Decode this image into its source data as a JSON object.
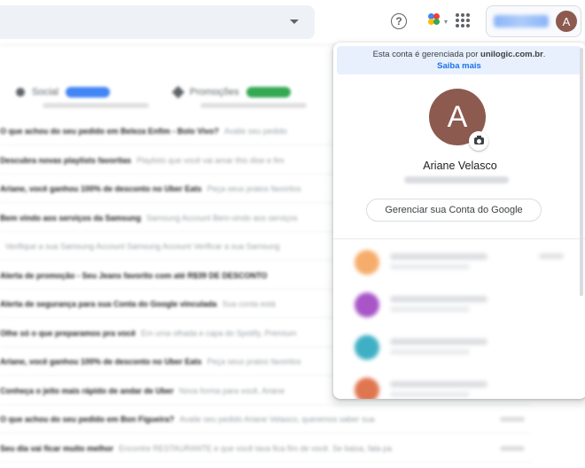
{
  "topbar": {
    "help_icon_glyph": "?",
    "account_initial": "A"
  },
  "inbox": {
    "tabs": [
      {
        "label": "Social",
        "color": "#4285f4"
      },
      {
        "label": "Promoções",
        "color": "#34a853"
      }
    ],
    "rows": [
      {
        "subject": "O que achou do seu pedido em Beleza Enfim - Bolo Vivo?",
        "preview": "Avalie seu pedido"
      },
      {
        "subject": "Descubra novas playlists favoritas",
        "preview": "Playlists que você vai amar this dise e fim"
      },
      {
        "subject": "Ariane, você ganhou 100% de desconto no Uber Eats",
        "preview": "Peça seus pratos favoritos"
      },
      {
        "subject": "Bem vindo aos serviços da Samsung",
        "preview": "Samsung Account Bem-vindo aos serviços"
      },
      {
        "subject": "",
        "preview": "Verifique a sua Samsung Account Samsung Account Verificar a sua Samsung"
      },
      {
        "subject": "Alerta de promoção - Seu Jeans favorito com até R$39 DE DESCONTO",
        "preview": ""
      },
      {
        "subject": "Alerta de segurança para sua Conta do Google vinculada",
        "preview": "Sua conta está"
      },
      {
        "subject": "Olhe só o que preparamos pra você",
        "preview": "Em uma olhada e capa do Spotify, Premium"
      },
      {
        "subject": "Ariane, você ganhou 100% de desconto no Uber Eats",
        "preview": "Peça seus pratos favoritos"
      },
      {
        "subject": "Conheça o jeito mais rápido de andar de Uber",
        "preview": "Nova forma para você, Ariane"
      },
      {
        "subject": "O que achou do seu pedido em Bon Figueira?",
        "preview": "Avalie seu pedido Ariane Velasco, queremos saber sua"
      },
      {
        "subject": "Seu dia vai ficar muito melhor",
        "preview": "Encontre RESTAURANTE e que você tava fica fim de você. Se baixa, fala pa"
      }
    ]
  },
  "popup": {
    "managed_prefix": "Esta conta é gerenciada por ",
    "managed_domain": "unilogic.com.br",
    "managed_suffix": ".",
    "learn_more": "Saiba mais",
    "avatar_initial": "A",
    "user_name": "Ariane Velasco",
    "manage_button": "Gerenciar sua Conta do Google",
    "other_accounts": [
      {
        "color": "#f6ad6b"
      },
      {
        "color": "#a855c7"
      },
      {
        "color": "#3fb0c4"
      },
      {
        "color": "#e0764f"
      }
    ]
  }
}
